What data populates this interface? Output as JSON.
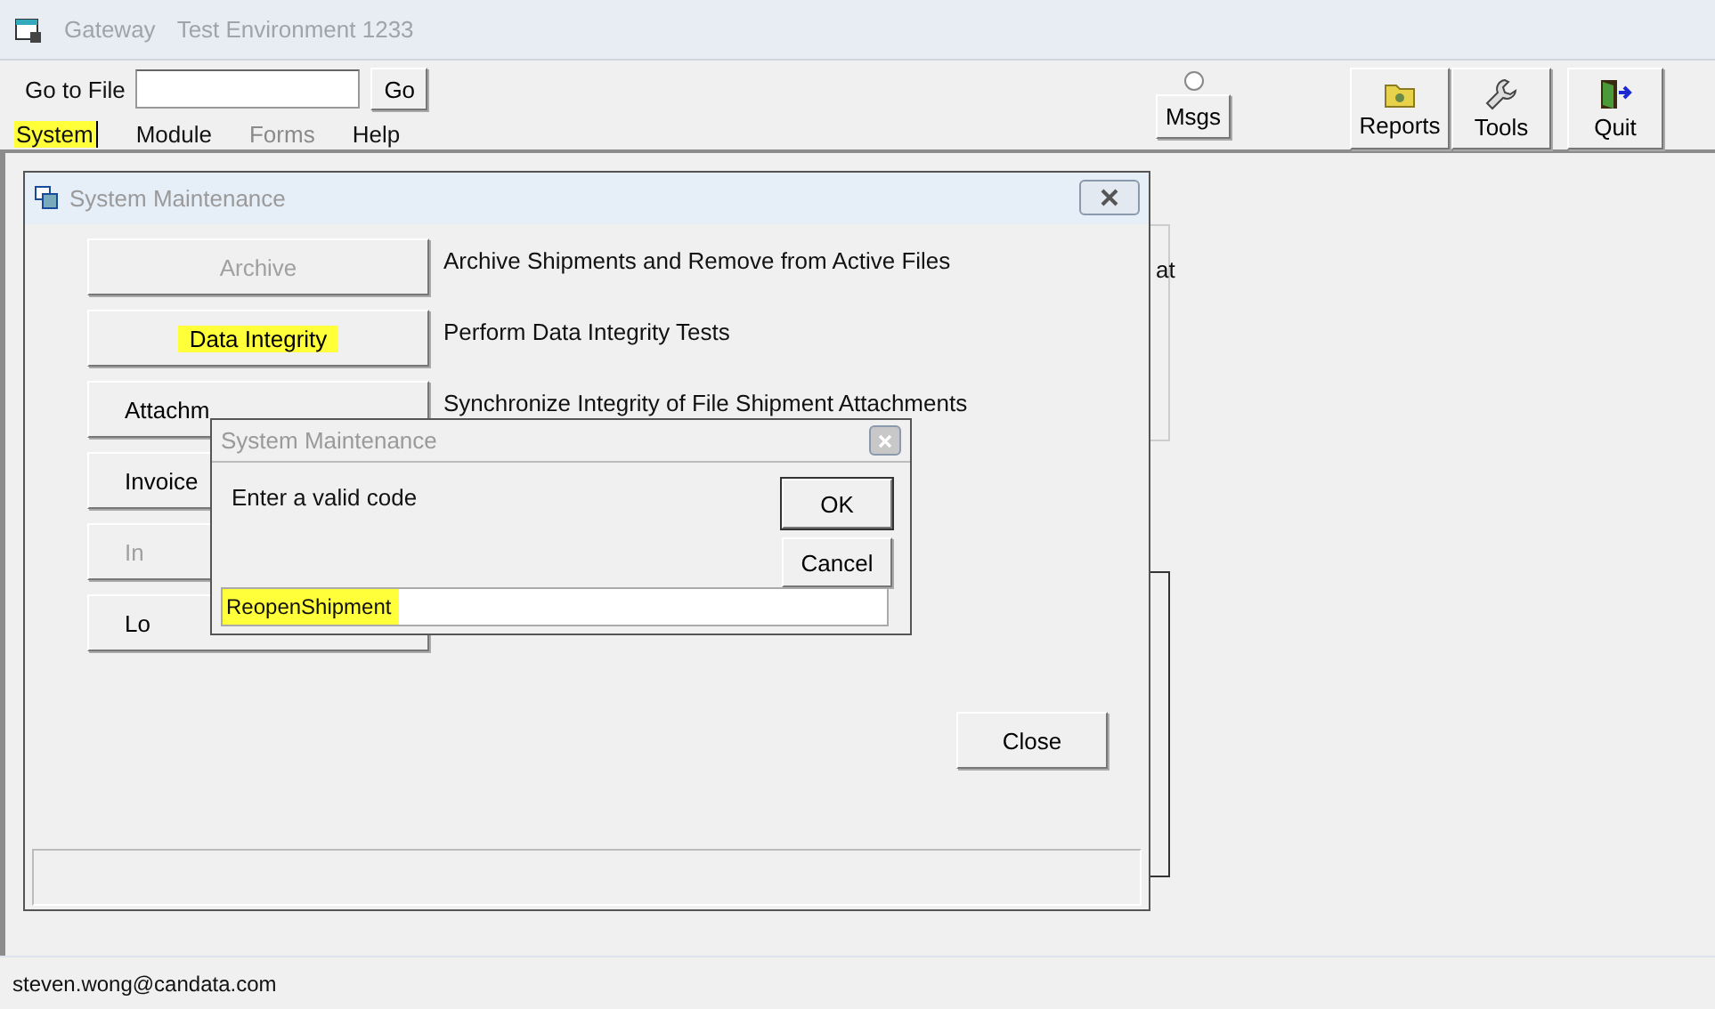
{
  "app_window": {
    "title": "Gateway",
    "subtitle": "Test Environment 1233",
    "active": false
  },
  "toolbar": {
    "goto_label": "Go to File",
    "go_button": "Go",
    "msgs_button": "Msgs",
    "msgs_radio_checked": false,
    "tool_buttons": [
      {
        "label": "Reports",
        "kind": "reports"
      },
      {
        "label": "Tools",
        "kind": "tools"
      },
      {
        "label": "Quit",
        "kind": "quit"
      }
    ]
  },
  "menu": [
    {
      "label": "System",
      "disabled": false,
      "highlighted": true
    },
    {
      "label": "Module",
      "disabled": false,
      "highlighted": false
    },
    {
      "label": "Forms",
      "disabled": true,
      "highlighted": false
    },
    {
      "label": "Help",
      "disabled": false,
      "highlighted": false
    }
  ],
  "background_panel_text": "at",
  "maintenance_window": {
    "title": "System Maintenance",
    "active": false,
    "rows": [
      {
        "button": "Archive",
        "disabled": true,
        "highlighted": false,
        "description": "Archive Shipments and Remove from Active Files"
      },
      {
        "button": "Data Integrity",
        "disabled": false,
        "highlighted": true,
        "description": "Perform Data Integrity Tests"
      },
      {
        "button": "Attachm",
        "disabled": false,
        "highlighted": false,
        "description": "Synchronize Integrity of File Shipment Attachments"
      },
      {
        "button": "Invoice",
        "disabled": false,
        "highlighted": false
      },
      {
        "button": "In",
        "disabled": true,
        "highlighted": false
      },
      {
        "button": "Lo",
        "disabled": false,
        "highlighted": false
      }
    ],
    "close_button": {
      "label": "Close"
    }
  },
  "code_dialog": {
    "title": "System Maintenance",
    "message": "Enter a valid code",
    "ok_button": {
      "label": "OK"
    },
    "cancel_button": {
      "label": "Cancel"
    },
    "value": "ReopenShipment",
    "value_highlighted": true
  },
  "status_bar": {
    "text": "steven.wong@candata.com"
  }
}
